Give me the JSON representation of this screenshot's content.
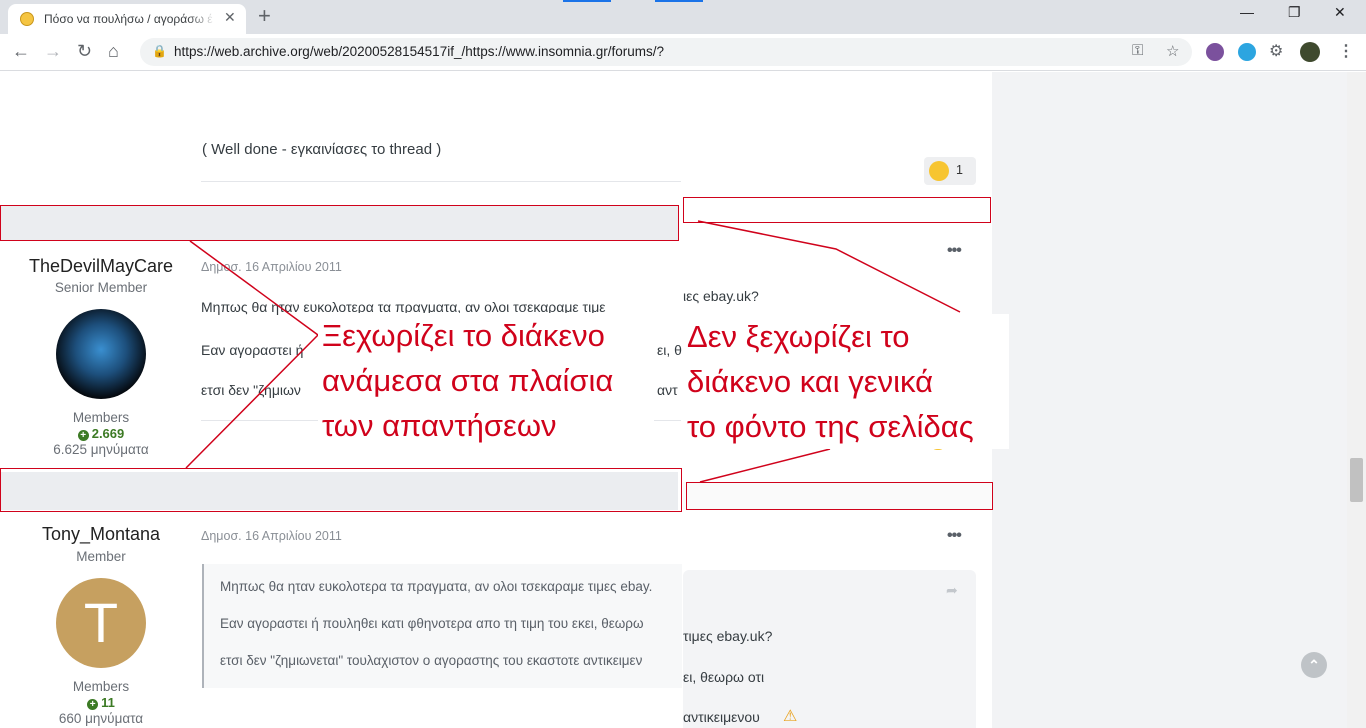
{
  "browser": {
    "tab_title": "Πόσο να πουλήσω / αγοράσω έ",
    "tab_close": "✕",
    "new_tab": "+",
    "url": "https://web.archive.org/web/20200528154517if_/https://www.insomnia.gr/forums/?",
    "window_controls": {
      "minimize": "—",
      "maximize": "❐",
      "close": "✕"
    },
    "nav": {
      "back": "←",
      "forward": "→",
      "reload": "↻",
      "home": "⌂"
    }
  },
  "first_post": {
    "text": "( Well done - εγκαινίασες το thread        )",
    "reaction_count": "1"
  },
  "posts": [
    {
      "username": "TheDevilMayCare",
      "rank": "Senior Member",
      "group": "Members",
      "reputation": "2.669",
      "post_count": "6.625 μηνύματα",
      "date": "Δημοσ. 16 Απριλίου 2011",
      "lines": [
        "Μηπως θα ηταν ευκολοτερα τα πραγματα, αν ολοι τσεκαραμε τιμε",
        "Εαν αγοραστει ή",
        "ετσι δεν  \"ζημιων"
      ],
      "right_lines": [
        "ιες ebay.uk?",
        "ει, θ",
        "αντ"
      ]
    },
    {
      "username": "Tony_Montana",
      "rank": "Member",
      "avatar_letter": "T",
      "group": "Members",
      "reputation": "11",
      "post_count": "660 μηνύματα",
      "date": "Δημοσ. 16 Απριλίου 2011",
      "quote_lines": [
        "Μηπως θα ηταν ευκολοτερα τα πραγματα, αν ολοι τσεκαραμε τιμες ebay.",
        "Εαν αγοραστει ή πουληθει κατι φθηνοτερα απο τη τιμη του εκει, θεωρω",
        "ετσι δεν \"ζημιωνεται\" τουλαχιστον ο αγοραστης του εκαστοτε αντικειμεν"
      ],
      "quote_right_lines": [
        "τιμες ebay.uk?",
        "ει, θεωρω οτι",
        "αντικειμενου"
      ]
    }
  ],
  "annotations": {
    "left_callout": [
      "Ξεχωρίζει το διάκενο",
      "ανάμεσα στα πλαίσια",
      "των απαντήσεων"
    ],
    "right_callout": [
      "Δεν ξεχωρίζει το",
      "διάκενο και γενικά",
      "το φόντο της σελίδας"
    ],
    "color": "#d0021b"
  },
  "colors": {
    "accent_green": "#3c7a24",
    "gap_band": "#ebedf0",
    "annotation_red": "#d0021b"
  }
}
